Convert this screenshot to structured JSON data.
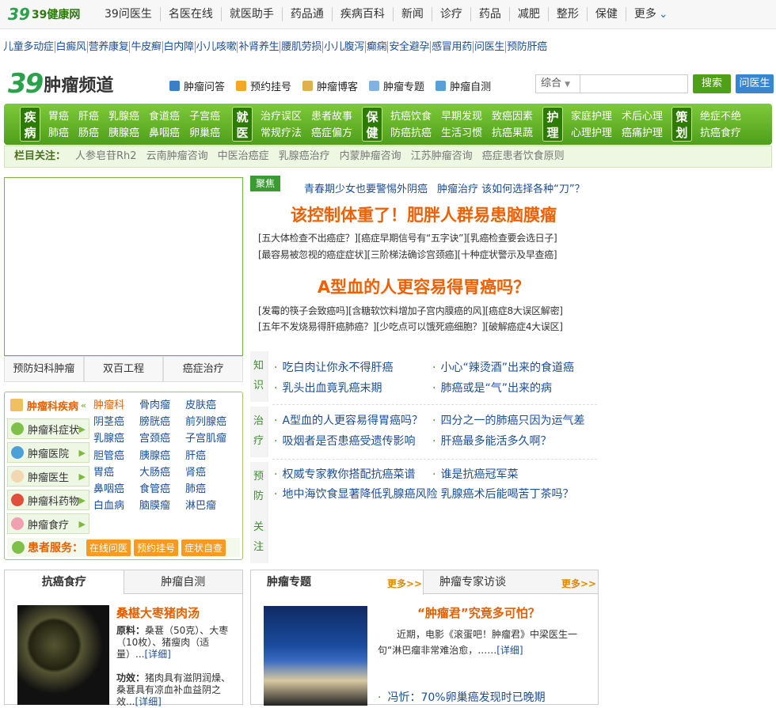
{
  "topbar": {
    "logo": "39健康网",
    "logo_num": "39",
    "nav": [
      "39问医生",
      "名医在线",
      "就医助手",
      "药品通",
      "疾病百科",
      "新闻",
      "诊疗",
      "药品",
      "减肥",
      "整形",
      "保健",
      "更多"
    ]
  },
  "quick_links": [
    "儿童多动症",
    "白癜风",
    "营养康复",
    "牛皮癣",
    "白内障",
    "小儿咳嗽",
    "补肾养生",
    "腰肌劳损",
    "小儿腹泻",
    "癫痫",
    "安全避孕",
    "感冒用药",
    "问医生",
    "预防肝癌"
  ],
  "brand": {
    "num": "39",
    "title": "肿瘤频道"
  },
  "tools": [
    "肿瘤问答",
    "预约挂号",
    "肿瘤博客",
    "肿瘤专题",
    "肿瘤自测"
  ],
  "search": {
    "select": "综合",
    "button": "搜索",
    "ask": "问医生"
  },
  "navbar": {
    "groups": [
      {
        "tag": "疾病",
        "items": [
          "胃癌",
          "肝癌",
          "乳腺癌",
          "食道癌",
          "子宫癌",
          "肺癌",
          "肠癌",
          "胰腺癌",
          "鼻咽癌",
          "卵巢癌"
        ]
      },
      {
        "tag": "就医",
        "items": [
          "治疗误区",
          "患者故事",
          "常规疗法",
          "癌症偏方"
        ]
      },
      {
        "tag": "保健",
        "items": [
          "抗癌饮食",
          "早期发现",
          "致癌因素",
          "防癌抗癌",
          "生活习惯",
          "抗癌果蔬"
        ]
      },
      {
        "tag": "护理",
        "items": [
          "家庭护理",
          "术后心理",
          "心理护理",
          "癌痛护理"
        ]
      },
      {
        "tag": "策划",
        "items": [
          "绝症不绝",
          "抗癌食疗"
        ]
      }
    ]
  },
  "focus": {
    "label": "栏目关注：",
    "items": [
      "人参皂苷Rh2",
      "云南肿瘤咨询",
      "中医治癌症",
      "乳腺癌治疗",
      "内蒙肿瘤咨询",
      "江苏肿瘤咨询",
      "癌症患者饮食原则"
    ]
  },
  "ad_tabs": [
    "预防妇科肿瘤",
    "双百工程",
    "癌症治疗"
  ],
  "dept": {
    "header": "肿瘤科疾病",
    "side": [
      "肿瘤科症状",
      "肿瘤医院",
      "肿瘤医生",
      "肿瘤科药物",
      "肿瘤食疗"
    ],
    "diseases": [
      "肿瘤科",
      "骨肉瘤",
      "皮肤癌",
      "阴茎癌",
      "膀胱癌",
      "前列腺癌",
      "乳腺癌",
      "宫颈癌",
      "子宫肌瘤",
      "胆管癌",
      "胰腺癌",
      "肝癌",
      "胃癌",
      "大肠癌",
      "肾癌",
      "鼻咽癌",
      "食管癌",
      "肺癌",
      "白血病",
      "脑膜瘤",
      "淋巴瘤"
    ],
    "service_label": "患者服务：",
    "services": [
      "在线问医",
      "预约挂号",
      "症状自查"
    ]
  },
  "feature": {
    "tag": "聚焦",
    "top": [
      "青春期少女也要警惕外阴癌",
      "肿瘤治疗 该如何选择各种“刀”？"
    ],
    "h1": "该控制体重了！肥胖人群易患脑膜瘤",
    "sub1": [
      "[五大体检查不出癌症？]",
      "[癌症早期信号有“五字诀”]",
      "[乳癌检查要会选日子]"
    ],
    "sub2": [
      "[最容易被忽视的癌症症状]",
      "[三阶梯法确诊宫颈癌]",
      "[十种症状警示及早查癌]"
    ],
    "h2": "A型血的人更容易得胃癌吗？",
    "sub3": [
      "[发霉的筷子会致癌吗]",
      "[含糖软饮料增加子宫内膜癌的风]",
      "[癌症8大误区解密]"
    ],
    "sub4": [
      "[五年不发烧易得肝癌肺癌？]",
      "[少吃点可以饿死癌细胞？]",
      "[破解癌症4大误区]"
    ]
  },
  "knowledge": [
    {
      "tag": "知识",
      "items": [
        "吃白肉让你永不得肝癌",
        "小心“辣烫酒”出来的食道癌",
        "乳头出血竟乳癌末期",
        "肺癌或是“气”出来的病"
      ]
    },
    {
      "tag": "治疗",
      "items": [
        "A型血的人更容易得胃癌吗？",
        "四分之一的肺癌只因为运气差",
        "吸烟者是否患癌受遗传影响",
        "肝癌最多能活多久啊？"
      ]
    },
    {
      "tag": "预防",
      "items": [
        "权威专家教你搭配抗癌菜谱",
        "谁是抗癌冠军菜",
        "地中海饮食显著降低乳腺癌风险",
        "乳腺癌术后能喝苦丁茶吗？"
      ]
    },
    {
      "tag": "关注",
      "items": []
    }
  ],
  "food": {
    "tab_on": "抗癌食疗",
    "tab2": "肿瘤自测",
    "title": "桑椹大枣猪肉汤",
    "material_label": "原料：",
    "material": "桑葚（50克）、大枣（10枚）、猪瘦肉（适量）...",
    "link": "[详细]",
    "effect_label": "功效：",
    "effect": "猪肉具有滋阴润燥、桑葚具有凉血补血益阴之效...",
    "link2": "[详细]"
  },
  "topic": {
    "tab_on": "肿瘤专题",
    "more1": "更多>>",
    "tab2": "肿瘤专家访谈",
    "more2": "更多>>",
    "title": "“肿瘤君”究竟多可怕？",
    "text": "近期，电影《滚蛋吧！肿瘤君》中梁医生一句“淋巴瘤非常难治愈，……",
    "link": "[详细]",
    "item": "冯忻：70%卵巢癌发现时已晚期"
  },
  "colors": {
    "green": "#4f9f19",
    "orange": "#f06000",
    "blue": "#1a4d9c"
  }
}
